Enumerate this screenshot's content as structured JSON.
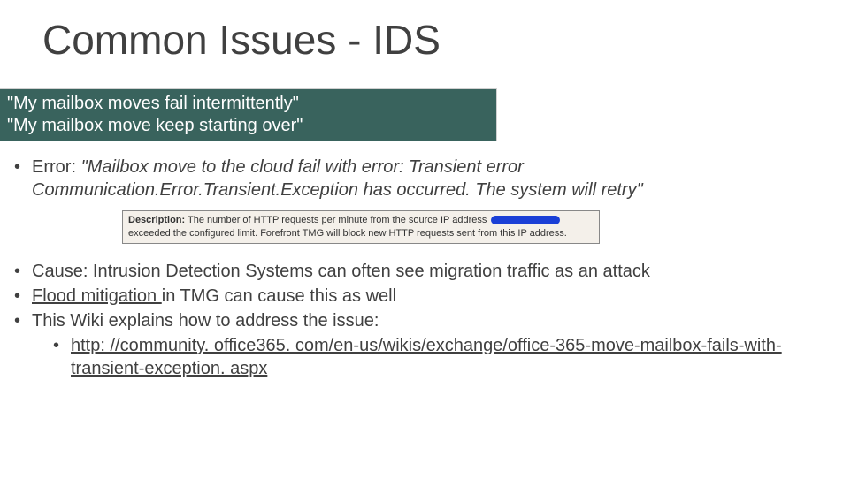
{
  "title": "Common Issues - IDS",
  "quotes": {
    "line1": "\"My mailbox moves fail intermittently\"",
    "line2": "\"My mailbox move keep starting over\""
  },
  "bullets": {
    "error_label": "Error: ",
    "error_text": "\"Mailbox move to the cloud fail with error: Transient error Communication.Error.Transient.Exception has occurred. The system will retry\"",
    "desc": {
      "label": "Description:",
      "before": " The number of HTTP requests per minute from the source IP address ",
      "after": " exceeded the configured limit. Forefront TMG will block new HTTP requests sent from this IP address."
    },
    "cause": "Cause: Intrusion Detection Systems can often see migration traffic as an attack",
    "flood_link": "Flood mitigation ",
    "flood_rest": "in TMG can cause this as well",
    "wiki": "This Wiki explains how to address the issue:",
    "url": "http: //community. office365. com/en-us/wikis/exchange/office-365-move-mailbox-fails-with-transient-exception. aspx"
  }
}
